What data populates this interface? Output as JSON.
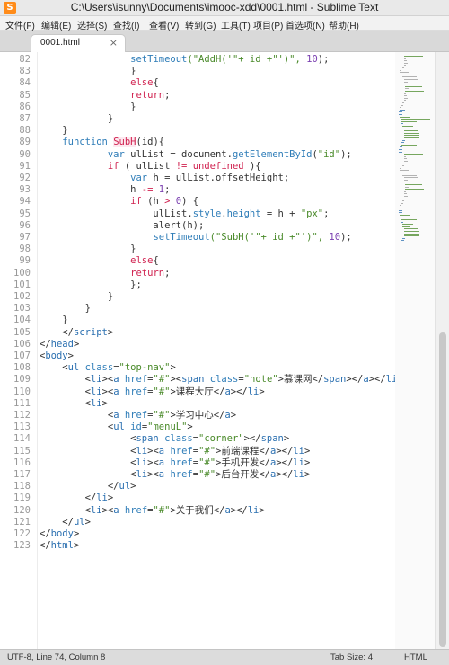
{
  "window": {
    "title": "C:\\Users\\isunny\\Documents\\imooc-xdd\\0001.html - Sublime Text"
  },
  "menu": [
    "文件(F)",
    "编辑(E)",
    "选择(S)",
    "查找(I)",
    "查看(V)",
    "转到(G)",
    "工具(T)",
    "项目(P)",
    "首选项(N)",
    "帮助(H)"
  ],
  "tab": {
    "label": "0001.html",
    "close": "×"
  },
  "colors": {
    "keyword": "#2f7db8",
    "string": "#4a8a2a",
    "tag": "#2a6fb0",
    "builtin": "#d0214f",
    "text": "#333333",
    "number": "#7a3fb0"
  },
  "editor": {
    "lines": [
      {
        "n": "82",
        "parts": [
          [
            "                ",
            ""
          ],
          [
            "setTimeout",
            "fn"
          ],
          [
            "(\"AddH('\"+ id +\"')\", ",
            "str"
          ],
          [
            "10",
            "num"
          ],
          [
            ");",
            ""
          ]
        ]
      },
      {
        "n": "83",
        "parts": [
          [
            "                }",
            ""
          ]
        ]
      },
      {
        "n": "84",
        "parts": [
          [
            "                ",
            ""
          ],
          [
            "else",
            "kw"
          ],
          [
            "{",
            ""
          ]
        ]
      },
      {
        "n": "85",
        "parts": [
          [
            "                ",
            ""
          ],
          [
            "return",
            "kw"
          ],
          [
            ";",
            ""
          ]
        ]
      },
      {
        "n": "86",
        "parts": [
          [
            "                }",
            ""
          ]
        ]
      },
      {
        "n": "87",
        "parts": [
          [
            "            }",
            ""
          ]
        ]
      },
      {
        "n": "88",
        "parts": [
          [
            "    }",
            ""
          ]
        ]
      },
      {
        "n": "89",
        "parts": [
          [
            "    ",
            ""
          ],
          [
            "function",
            "kwb"
          ],
          [
            " ",
            ""
          ],
          [
            "SubH",
            "name"
          ],
          [
            "(id){",
            ""
          ]
        ]
      },
      {
        "n": "90",
        "parts": [
          [
            "            ",
            ""
          ],
          [
            "var",
            "kwb"
          ],
          [
            " ulList = document.",
            ""
          ],
          [
            "getElementById",
            "fn"
          ],
          [
            "(",
            ""
          ],
          [
            "\"id\"",
            "str"
          ],
          [
            ");",
            ""
          ]
        ]
      },
      {
        "n": "91",
        "parts": [
          [
            "            ",
            ""
          ],
          [
            "if",
            "kw"
          ],
          [
            " ( ulList ",
            ""
          ],
          [
            "!=",
            "kw"
          ],
          [
            " ",
            ""
          ],
          [
            "undefined",
            "builtin"
          ],
          [
            " ){",
            ""
          ]
        ]
      },
      {
        "n": "92",
        "parts": [
          [
            "                ",
            ""
          ],
          [
            "var",
            "kwb"
          ],
          [
            " h = ulList.offsetHeight;",
            ""
          ]
        ]
      },
      {
        "n": "93",
        "parts": [
          [
            "                h ",
            ""
          ],
          [
            "-=",
            "kw"
          ],
          [
            " ",
            ""
          ],
          [
            "1",
            "num"
          ],
          [
            ";",
            ""
          ]
        ]
      },
      {
        "n": "94",
        "parts": [
          [
            "                ",
            ""
          ],
          [
            "if",
            "kw"
          ],
          [
            " (h ",
            ""
          ],
          [
            ">",
            "kw"
          ],
          [
            " ",
            ""
          ],
          [
            "0",
            "num"
          ],
          [
            ") {",
            ""
          ]
        ]
      },
      {
        "n": "95",
        "parts": [
          [
            "                    ulList.",
            ""
          ],
          [
            "style",
            "fn"
          ],
          [
            ".",
            ""
          ],
          [
            "height",
            "fn"
          ],
          [
            " = h + ",
            ""
          ],
          [
            "\"px\"",
            "str"
          ],
          [
            ";",
            ""
          ]
        ]
      },
      {
        "n": "96",
        "parts": [
          [
            "                    alert(h);",
            ""
          ]
        ]
      },
      {
        "n": "97",
        "parts": [
          [
            "                    ",
            ""
          ],
          [
            "setTimeout",
            "fn"
          ],
          [
            "(\"SubH('\"+ id +\"')\", ",
            "str"
          ],
          [
            "10",
            "num"
          ],
          [
            ");",
            ""
          ]
        ]
      },
      {
        "n": "98",
        "parts": [
          [
            "                }",
            ""
          ]
        ]
      },
      {
        "n": "99",
        "parts": [
          [
            "                ",
            ""
          ],
          [
            "else",
            "kw"
          ],
          [
            "{",
            ""
          ]
        ]
      },
      {
        "n": "100",
        "parts": [
          [
            "                ",
            ""
          ],
          [
            "return",
            "kw"
          ],
          [
            ";",
            ""
          ]
        ]
      },
      {
        "n": "101",
        "parts": [
          [
            "                };",
            ""
          ]
        ]
      },
      {
        "n": "102",
        "parts": [
          [
            "            }",
            ""
          ]
        ]
      },
      {
        "n": "103",
        "parts": [
          [
            "        }",
            ""
          ]
        ]
      },
      {
        "n": "104",
        "parts": [
          [
            "    }",
            ""
          ]
        ]
      },
      {
        "n": "105",
        "parts": [
          [
            "    </",
            ""
          ],
          [
            "script",
            "tag"
          ],
          [
            ">",
            ""
          ]
        ]
      },
      {
        "n": "106",
        "parts": [
          [
            "</",
            ""
          ],
          [
            "head",
            "tag"
          ],
          [
            ">",
            ""
          ]
        ]
      },
      {
        "n": "107",
        "parts": [
          [
            "<",
            ""
          ],
          [
            "body",
            "tag"
          ],
          [
            ">",
            ""
          ]
        ]
      },
      {
        "n": "108",
        "parts": [
          [
            "    <",
            ""
          ],
          [
            "ul",
            "tag"
          ],
          [
            " ",
            ""
          ],
          [
            "class",
            "attr"
          ],
          [
            "=",
            ""
          ],
          [
            "\"top-nav\"",
            "str"
          ],
          [
            ">",
            ""
          ]
        ]
      },
      {
        "n": "109",
        "parts": [
          [
            "        <",
            ""
          ],
          [
            "li",
            "tag"
          ],
          [
            "><",
            ""
          ],
          [
            "a",
            "tag"
          ],
          [
            " ",
            ""
          ],
          [
            "href",
            "attr"
          ],
          [
            "=",
            ""
          ],
          [
            "\"#\"",
            "str"
          ],
          [
            "><",
            ""
          ],
          [
            "span",
            "tag"
          ],
          [
            " ",
            ""
          ],
          [
            "class",
            "attr"
          ],
          [
            "=",
            ""
          ],
          [
            "\"note\"",
            "str"
          ],
          [
            ">慕课网</",
            ""
          ],
          [
            "span",
            "tag"
          ],
          [
            "></",
            ""
          ],
          [
            "a",
            "tag"
          ],
          [
            "></",
            ""
          ],
          [
            "li",
            "tag"
          ],
          [
            ">",
            ""
          ]
        ]
      },
      {
        "n": "110",
        "parts": [
          [
            "        <",
            ""
          ],
          [
            "li",
            "tag"
          ],
          [
            "><",
            ""
          ],
          [
            "a",
            "tag"
          ],
          [
            " ",
            ""
          ],
          [
            "href",
            "attr"
          ],
          [
            "=",
            ""
          ],
          [
            "\"#\"",
            "str"
          ],
          [
            ">课程大厅</",
            ""
          ],
          [
            "a",
            "tag"
          ],
          [
            "></",
            ""
          ],
          [
            "li",
            "tag"
          ],
          [
            ">",
            ""
          ]
        ]
      },
      {
        "n": "111",
        "parts": [
          [
            "        <",
            ""
          ],
          [
            "li",
            "tag"
          ],
          [
            ">",
            ""
          ]
        ]
      },
      {
        "n": "112",
        "parts": [
          [
            "            <",
            ""
          ],
          [
            "a",
            "tag"
          ],
          [
            " ",
            ""
          ],
          [
            "href",
            "attr"
          ],
          [
            "=",
            ""
          ],
          [
            "\"#\"",
            "str"
          ],
          [
            ">学习中心</",
            ""
          ],
          [
            "a",
            "tag"
          ],
          [
            ">",
            ""
          ]
        ]
      },
      {
        "n": "113",
        "parts": [
          [
            "            <",
            ""
          ],
          [
            "ul",
            "tag"
          ],
          [
            " ",
            ""
          ],
          [
            "id",
            "attr"
          ],
          [
            "=",
            ""
          ],
          [
            "\"menuL\"",
            "str"
          ],
          [
            ">",
            ""
          ]
        ]
      },
      {
        "n": "114",
        "parts": [
          [
            "                <",
            ""
          ],
          [
            "span",
            "tag"
          ],
          [
            " ",
            ""
          ],
          [
            "class",
            "attr"
          ],
          [
            "=",
            ""
          ],
          [
            "\"corner\"",
            "str"
          ],
          [
            "></",
            ""
          ],
          [
            "span",
            "tag"
          ],
          [
            ">",
            ""
          ]
        ]
      },
      {
        "n": "115",
        "parts": [
          [
            "                <",
            ""
          ],
          [
            "li",
            "tag"
          ],
          [
            "><",
            ""
          ],
          [
            "a",
            "tag"
          ],
          [
            " ",
            ""
          ],
          [
            "href",
            "attr"
          ],
          [
            "=",
            ""
          ],
          [
            "\"#\"",
            "str"
          ],
          [
            ">前端课程</",
            ""
          ],
          [
            "a",
            "tag"
          ],
          [
            "></",
            ""
          ],
          [
            "li",
            "tag"
          ],
          [
            ">",
            ""
          ]
        ]
      },
      {
        "n": "116",
        "parts": [
          [
            "                <",
            ""
          ],
          [
            "li",
            "tag"
          ],
          [
            "><",
            ""
          ],
          [
            "a",
            "tag"
          ],
          [
            " ",
            ""
          ],
          [
            "href",
            "attr"
          ],
          [
            "=",
            ""
          ],
          [
            "\"#\"",
            "str"
          ],
          [
            ">手机开发</",
            ""
          ],
          [
            "a",
            "tag"
          ],
          [
            "></",
            ""
          ],
          [
            "li",
            "tag"
          ],
          [
            ">",
            ""
          ]
        ]
      },
      {
        "n": "117",
        "parts": [
          [
            "                <",
            ""
          ],
          [
            "li",
            "tag"
          ],
          [
            "><",
            ""
          ],
          [
            "a",
            "tag"
          ],
          [
            " ",
            ""
          ],
          [
            "href",
            "attr"
          ],
          [
            "=",
            ""
          ],
          [
            "\"#\"",
            "str"
          ],
          [
            ">后台开发</",
            ""
          ],
          [
            "a",
            "tag"
          ],
          [
            "></",
            ""
          ],
          [
            "li",
            "tag"
          ],
          [
            ">",
            ""
          ]
        ]
      },
      {
        "n": "118",
        "parts": [
          [
            "            </",
            ""
          ],
          [
            "ul",
            "tag"
          ],
          [
            ">",
            ""
          ]
        ]
      },
      {
        "n": "119",
        "parts": [
          [
            "        </",
            ""
          ],
          [
            "li",
            "tag"
          ],
          [
            ">",
            ""
          ]
        ]
      },
      {
        "n": "120",
        "parts": [
          [
            "        <",
            ""
          ],
          [
            "li",
            "tag"
          ],
          [
            "><",
            ""
          ],
          [
            "a",
            "tag"
          ],
          [
            " ",
            ""
          ],
          [
            "href",
            "attr"
          ],
          [
            "=",
            ""
          ],
          [
            "\"#\"",
            "str"
          ],
          [
            ">关于我们</",
            ""
          ],
          [
            "a",
            "tag"
          ],
          [
            "></",
            ""
          ],
          [
            "li",
            "tag"
          ],
          [
            ">",
            ""
          ]
        ]
      },
      {
        "n": "121",
        "parts": [
          [
            "    </",
            ""
          ],
          [
            "ul",
            "tag"
          ],
          [
            ">",
            ""
          ]
        ]
      },
      {
        "n": "122",
        "parts": [
          [
            "</",
            ""
          ],
          [
            "body",
            "tag"
          ],
          [
            ">",
            ""
          ]
        ]
      },
      {
        "n": "123",
        "parts": [
          [
            "</",
            ""
          ],
          [
            "html",
            "tag"
          ],
          [
            ">",
            ""
          ]
        ]
      }
    ]
  },
  "status": {
    "left": "UTF-8, Line 74, Column 8",
    "tab_size": "Tab Size: 4",
    "syntax": "HTML"
  }
}
